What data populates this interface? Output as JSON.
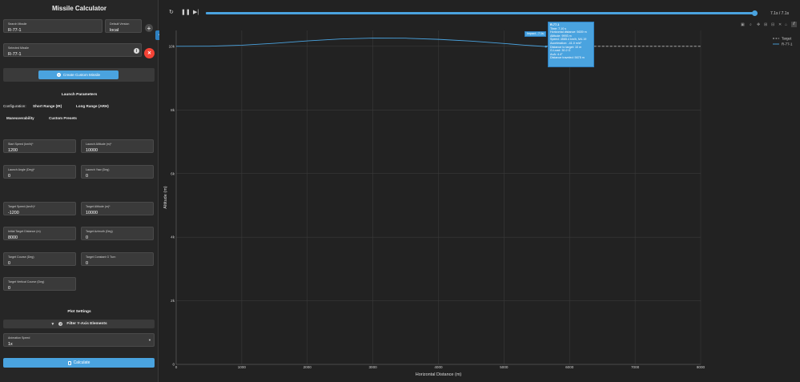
{
  "sidebar": {
    "title": "Missile Calculator",
    "search": {
      "label": "Search Missile",
      "value": "R-77-1"
    },
    "version": {
      "label": "Default Version",
      "value": "local"
    },
    "add_symbol": "+",
    "selected": {
      "label": "Selected Missile",
      "value": "R-77-1",
      "info_symbol": "i"
    },
    "remove_symbol": "✕",
    "create_button": "Create Custom Missile",
    "launch_title": "Launch Parameters",
    "configuration_label": "Configuration:",
    "config_options": [
      "Short Range (IR)",
      "Long Range (ARH)"
    ],
    "extra_options": [
      "Maneuverability",
      "Custom Presets"
    ],
    "fields": [
      {
        "label": "Start Speed (km/h)*",
        "value": "1200"
      },
      {
        "label": "Launch Altitude (m)*",
        "value": "10000"
      },
      {
        "label": "Launch Angle (Deg)*",
        "value": "0"
      },
      {
        "label": "Launch Yaw (Deg)",
        "value": "0"
      },
      {
        "label": "Target Speed (km/h)*",
        "value": "-1200"
      },
      {
        "label": "Target Altitude (m)*",
        "value": "10000"
      },
      {
        "label": "Initial Target Distance (m)",
        "value": "8000"
      },
      {
        "label": "Target Azimuth (Deg)",
        "value": "0"
      },
      {
        "label": "Target Course (Deg)",
        "value": "0"
      },
      {
        "label": "Target Constant G Turn",
        "value": "0"
      },
      {
        "label": "Target Vertical Course (Deg)",
        "value": "0"
      }
    ],
    "plot_title": "Plot Settings",
    "filter_button": "Filter Y-Axis Elements",
    "animation": {
      "label": "Animation Speed",
      "value": "1x"
    },
    "calculate_button": "Calculate"
  },
  "player": {
    "speed_text": "7.1s / 7.1s",
    "progress": 1.0
  },
  "tooltip": {
    "title": "R-77-1",
    "lines": [
      "Time: 7.10 s",
      "Horizontal distance: 5639 m",
      "Altitude: 9993 m",
      "Speed: 4565.4 km/h, M4.19",
      "Acceleration: -41.0 m/s²",
      "Distance to target: 10 m",
      "G-Load: 30.2 G",
      "AoA: 4.4°",
      "Distance traveled: 5675 m"
    ]
  },
  "impact_label": "Impact - 7.1s",
  "chart_data": {
    "type": "line",
    "xlabel": "Horizontal Distance (m)",
    "ylabel": "Altitude (m)",
    "xlim": [
      0,
      8000
    ],
    "ylim": [
      0,
      10500
    ],
    "xticks": [
      0,
      1000,
      2000,
      3000,
      4000,
      5000,
      6000,
      7000,
      8000
    ],
    "xtick_labels": [
      "0",
      "1000",
      "2000",
      "3000",
      "4000",
      "5000",
      "6000",
      "7000",
      "8000"
    ],
    "yticks": [
      0,
      2000,
      4000,
      6000,
      8000,
      10000
    ],
    "ytick_labels": [
      "0",
      "2k",
      "4k",
      "6k",
      "8k",
      "10k"
    ],
    "grid": true,
    "legend_position": "top-right",
    "series": [
      {
        "name": "Target",
        "style": "dashed",
        "color": "#bdbdbd",
        "x": [
          5639,
          8000
        ],
        "y": [
          10000,
          10000
        ]
      },
      {
        "name": "R-77-1",
        "style": "solid",
        "color": "#4aa3df",
        "x": [
          0,
          500,
          1000,
          1500,
          2000,
          2500,
          3000,
          3500,
          4000,
          4500,
          5000,
          5300,
          5639
        ],
        "y": [
          10000,
          10005,
          10035,
          10095,
          10170,
          10230,
          10260,
          10255,
          10220,
          10165,
          10090,
          10040,
          9993
        ]
      }
    ]
  },
  "colors": {
    "accent": "#4aa3df",
    "danger": "#f44336",
    "panel": "#262626",
    "plot_bg": "#222222"
  }
}
